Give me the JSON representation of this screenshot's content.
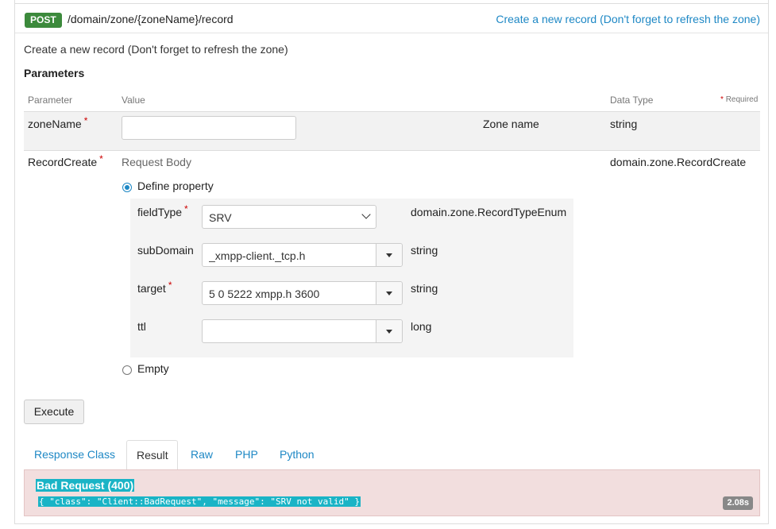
{
  "operation": {
    "method": "POST",
    "path": "/domain/zone/{zoneName}/record",
    "summary": "Create a new record (Don't forget to refresh the zone)",
    "description": "Create a new record (Don't forget to refresh the zone)"
  },
  "parameters": {
    "title": "Parameters",
    "columns": {
      "parameter": "Parameter",
      "value": "Value",
      "data_type": "Data Type",
      "required_star": "*",
      "required": "Required"
    },
    "zone_name": {
      "name": "zoneName",
      "star": "*",
      "value": "",
      "description": "Zone name",
      "type": "string"
    },
    "record_create": {
      "name": "RecordCreate",
      "star": "*",
      "value_label": "Request Body",
      "type": "domain.zone.RecordCreate",
      "define_property": "Define property",
      "empty": "Empty",
      "fields": {
        "field_type": {
          "label": "fieldType",
          "star": "*",
          "value": "SRV",
          "type": "domain.zone.RecordTypeEnum"
        },
        "sub_domain": {
          "label": "subDomain",
          "value": "_xmpp-client._tcp.h",
          "type": "string"
        },
        "target": {
          "label": "target",
          "star": "*",
          "value": "5 0 5222 xmpp.h 3600",
          "type": "string"
        },
        "ttl": {
          "label": "ttl",
          "value": "",
          "type": "long"
        }
      }
    }
  },
  "execute_label": "Execute",
  "tabs": [
    "Response Class",
    "Result",
    "Raw",
    "PHP",
    "Python"
  ],
  "active_tab": "Result",
  "result": {
    "title": "Bad Request (400)",
    "body": "{ \"class\": \"Client::BadRequest\", \"message\": \"SRV not valid\" }",
    "time": "2.08s"
  }
}
